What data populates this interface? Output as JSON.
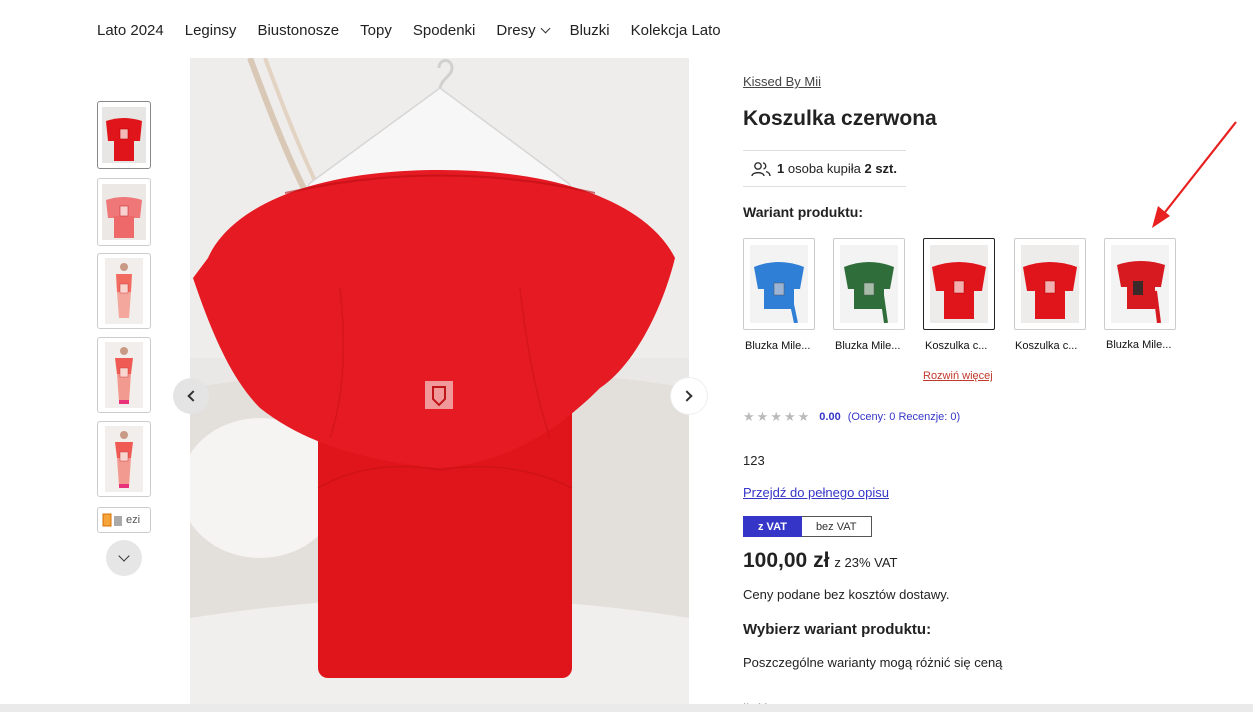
{
  "nav": {
    "items": [
      {
        "label": "Lato 2024"
      },
      {
        "label": "Leginsy"
      },
      {
        "label": "Biustonosze"
      },
      {
        "label": "Topy"
      },
      {
        "label": "Spodenki"
      },
      {
        "label": "Dresy",
        "has_dropdown": true
      },
      {
        "label": "Bluzki"
      },
      {
        "label": "Kolekcja Lato"
      }
    ]
  },
  "gallery": {
    "partial_thumb_label": "ezi"
  },
  "product": {
    "brand": "Kissed By Mii",
    "title": "Koszulka czerwona",
    "bought": {
      "count_people": "1",
      "text_mid": "osoba kupiła",
      "count_items": "2 szt."
    },
    "variant_label": "Wariant produktu:",
    "variants": [
      {
        "name": "Bluzka Mile...",
        "color": "#2f7fd6",
        "selected": false
      },
      {
        "name": "Bluzka Mile...",
        "color": "#2f6e3a",
        "selected": false
      },
      {
        "name": "Koszulka c...",
        "color": "#e0141b",
        "selected": true
      },
      {
        "name": "Koszulka c...",
        "color": "#e0141b",
        "selected": false
      },
      {
        "name": "Bluzka Mile...",
        "color": "#d61a20",
        "selected": false
      }
    ],
    "expand_label": "Rozwiń więcej",
    "rating": {
      "score": "0.00",
      "counts": "(Oceny: 0 Recenzje: 0)"
    },
    "short_description": "123",
    "full_description_link": "Przejdź do pełnego opisu",
    "vat_toggle": {
      "with_vat": "z VAT",
      "without_vat": "bez VAT"
    },
    "price": {
      "amount": "100,00 zł",
      "vat_note": "z 23% VAT"
    },
    "shipping_note": "Ceny podane bez kosztów dostawy.",
    "choose_variant": "Wybierz wariant produktu:",
    "variants_note": "Poszczególne warianty mogą różnić się ceną",
    "cut_text": "Ilość:"
  },
  "colors": {
    "accent": "#3535c8",
    "product_red": "#e0141b",
    "annotation": "#e8201f",
    "link_red": "#c0392b"
  }
}
